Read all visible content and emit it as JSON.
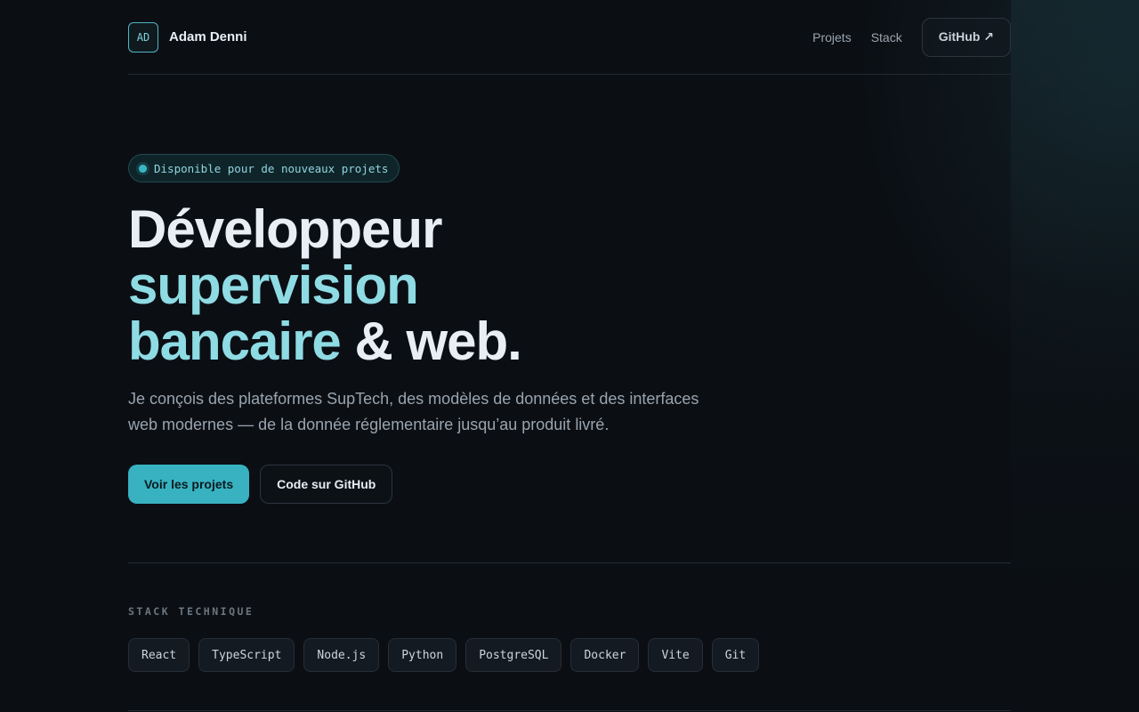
{
  "brand": {
    "initials": "AD",
    "name": "Adam Denni"
  },
  "nav": {
    "projects": "Projets",
    "stack": "Stack",
    "github": "GitHub ↗"
  },
  "hero": {
    "badge": "Disponible pour de nouveaux projets",
    "title_line1": "Développeur",
    "title_line2": "supervision",
    "title_line3_accent": "bancaire",
    "title_line3_rest": " & web.",
    "lead_line1": "Je conçois des plateformes SupTech, des modèles de données et des interfaces",
    "lead_line2": "web modernes — de la donnée réglementaire jusqu’au produit livré.",
    "cta_primary": "Voir les projets",
    "cta_secondary": "Code sur GitHub"
  },
  "stack": {
    "label": "STACK TECHNIQUE",
    "items": [
      "React",
      "TypeScript",
      "Node.js",
      "Python",
      "PostgreSQL",
      "Docker",
      "Vite",
      "Git"
    ]
  },
  "colors": {
    "accent": "#38b2c1",
    "accent_light": "#8fdbe4",
    "background": "#0b0f14"
  }
}
